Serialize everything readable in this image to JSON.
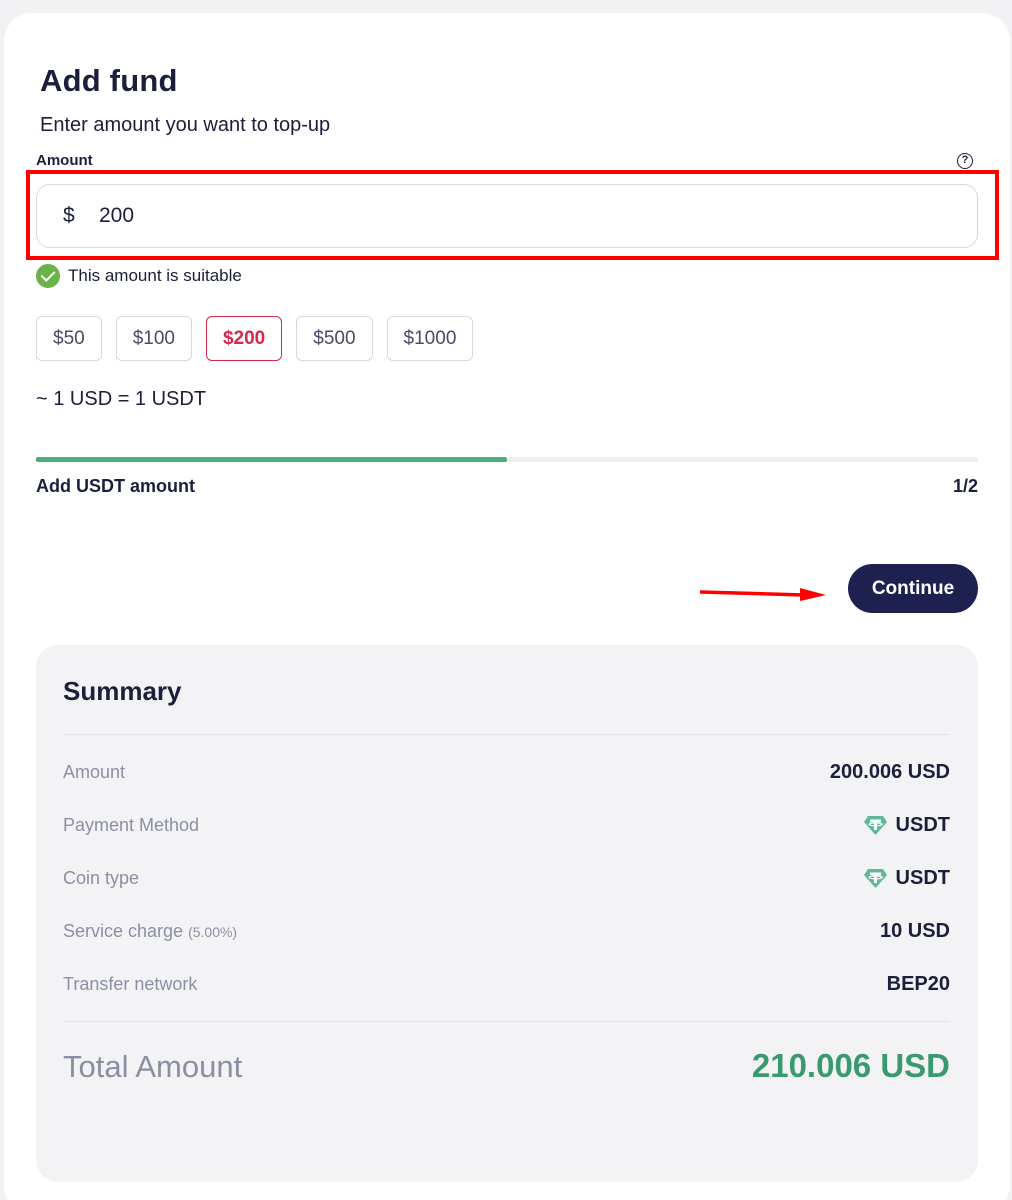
{
  "header": {
    "title": "Add fund",
    "subtitle": "Enter amount you want to top-up"
  },
  "amount": {
    "label": "Amount",
    "help_icon": "question-circle-icon",
    "currency_symbol": "$",
    "value": "200",
    "validation_message": "This amount is suitable",
    "validation_icon": "check-circle-icon"
  },
  "presets": [
    {
      "label": "$50",
      "selected": false
    },
    {
      "label": "$100",
      "selected": false
    },
    {
      "label": "$200",
      "selected": true
    },
    {
      "label": "$500",
      "selected": false
    },
    {
      "label": "$1000",
      "selected": false
    }
  ],
  "rate": "~ 1 USD = 1 USDT",
  "progress": {
    "label": "Add USDT amount",
    "step": "1/2",
    "fraction": 0.5
  },
  "continue_label": "Continue",
  "summary": {
    "title": "Summary",
    "rows": [
      {
        "label": "Amount",
        "note": "",
        "value": "200.006 USD",
        "icon": ""
      },
      {
        "label": "Payment Method",
        "note": "",
        "value": "USDT",
        "icon": "tether-icon"
      },
      {
        "label": "Coin type",
        "note": "",
        "value": "USDT",
        "icon": "tether-icon"
      },
      {
        "label": "Service charge",
        "note": "(5.00%)",
        "value": "10 USD",
        "icon": ""
      },
      {
        "label": "Transfer network",
        "note": "",
        "value": "BEP20",
        "icon": ""
      }
    ],
    "total_label": "Total Amount",
    "total_value": "210.006 USD"
  },
  "colors": {
    "brand_dark": "#1e2150",
    "accent_red": "#d6284f",
    "success_green": "#4caf78",
    "total_green": "#3a9a6f",
    "annotation_red": "#ff0000"
  }
}
